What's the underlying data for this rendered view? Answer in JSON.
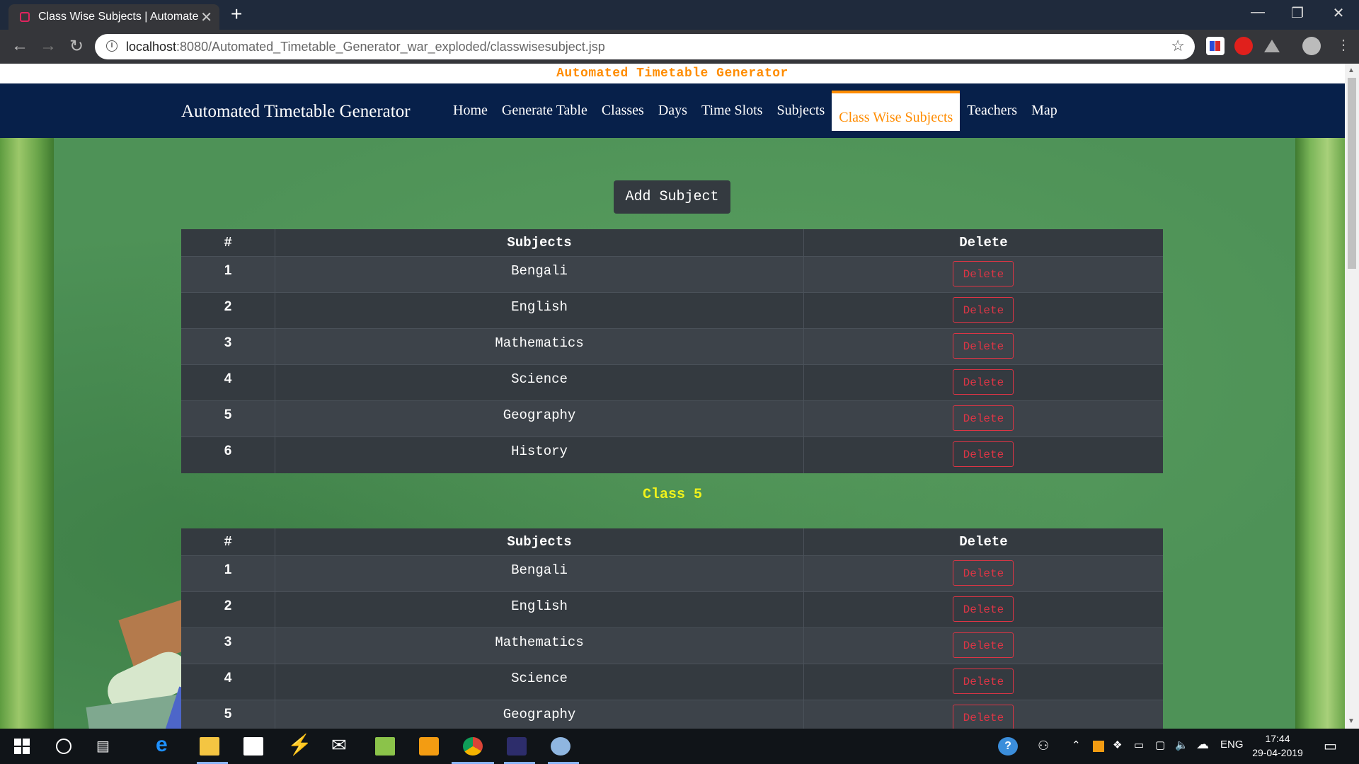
{
  "browser": {
    "tab_title": "Class Wise Subjects | Automated",
    "url_host": "localhost",
    "url_rest": ":8080/Automated_Timetable_Generator_war_exploded/classwisesubject.jsp"
  },
  "page": {
    "banner": "Automated Timetable Generator",
    "brand": "Automated Timetable Generator",
    "nav": [
      {
        "label": "Home"
      },
      {
        "label": "Generate Table"
      },
      {
        "label": "Classes"
      },
      {
        "label": "Days"
      },
      {
        "label": "Time Slots"
      },
      {
        "label": "Subjects"
      },
      {
        "label": "Class Wise Subjects",
        "active": true
      },
      {
        "label": "Teachers"
      },
      {
        "label": "Map"
      }
    ],
    "add_button": "Add Subject",
    "table_headers": [
      "#",
      "Subjects",
      "Delete"
    ],
    "delete_label": "Delete",
    "tables": [
      {
        "rows": [
          {
            "num": "1",
            "subject": "Bengali"
          },
          {
            "num": "2",
            "subject": "English"
          },
          {
            "num": "3",
            "subject": "Mathematics"
          },
          {
            "num": "4",
            "subject": "Science"
          },
          {
            "num": "5",
            "subject": "Geography"
          },
          {
            "num": "6",
            "subject": "History"
          }
        ]
      },
      {
        "class_label": "Class 5",
        "rows": [
          {
            "num": "1",
            "subject": "Bengali"
          },
          {
            "num": "2",
            "subject": "English"
          },
          {
            "num": "3",
            "subject": "Mathematics"
          },
          {
            "num": "4",
            "subject": "Science"
          },
          {
            "num": "5",
            "subject": "Geography"
          }
        ]
      }
    ]
  },
  "taskbar": {
    "language": "ENG",
    "time": "17:44",
    "date": "29-04-2019"
  },
  "colors": {
    "accent": "#ff8c00",
    "navbar": "#07204a",
    "table_bg": "#343a40",
    "danger": "#dc3545",
    "class_label": "#f1f31b"
  }
}
